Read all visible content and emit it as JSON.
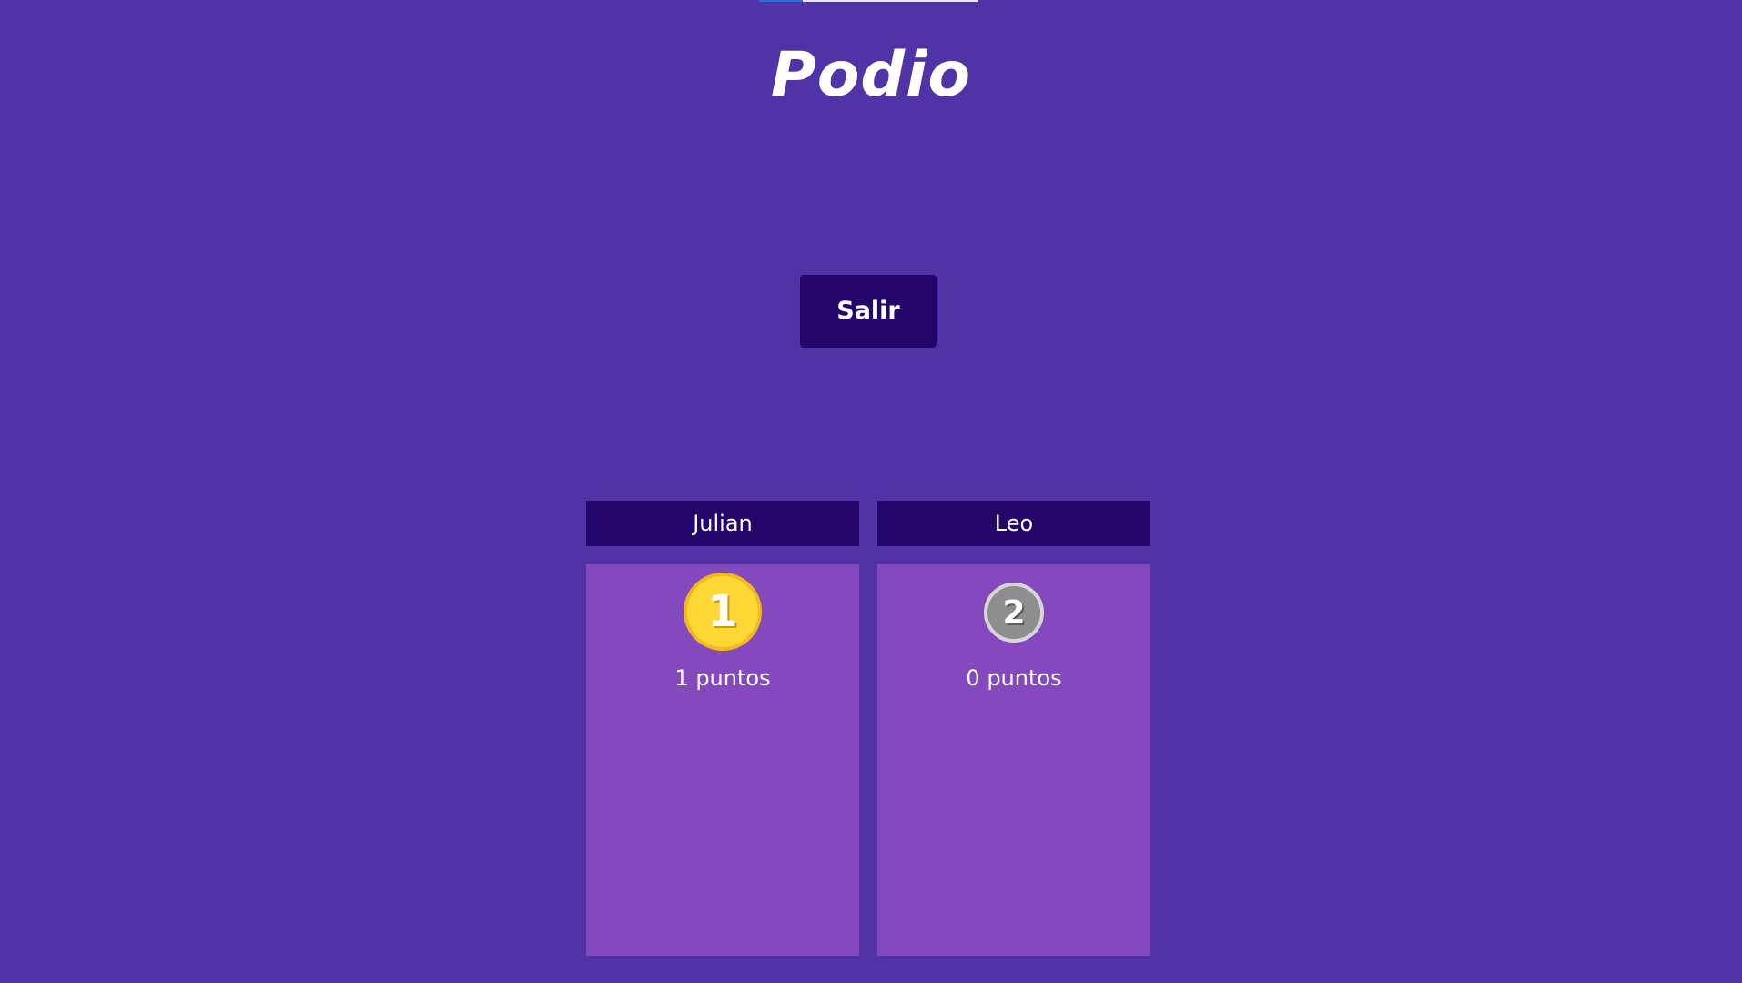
{
  "header": {
    "title": "Podio"
  },
  "actions": {
    "exit_label": "Salir"
  },
  "podium": [
    {
      "rank": "1",
      "name": "Julian",
      "points": "1 puntos",
      "medal_color": "#fdd835"
    },
    {
      "rank": "2",
      "name": "Leo",
      "points": "0 puntos",
      "medal_color": "#8e8e8e"
    }
  ],
  "colors": {
    "background": "#5033a6",
    "header_bg": "#24066b",
    "block_bg": "#844abd",
    "text": "#ffffff"
  }
}
